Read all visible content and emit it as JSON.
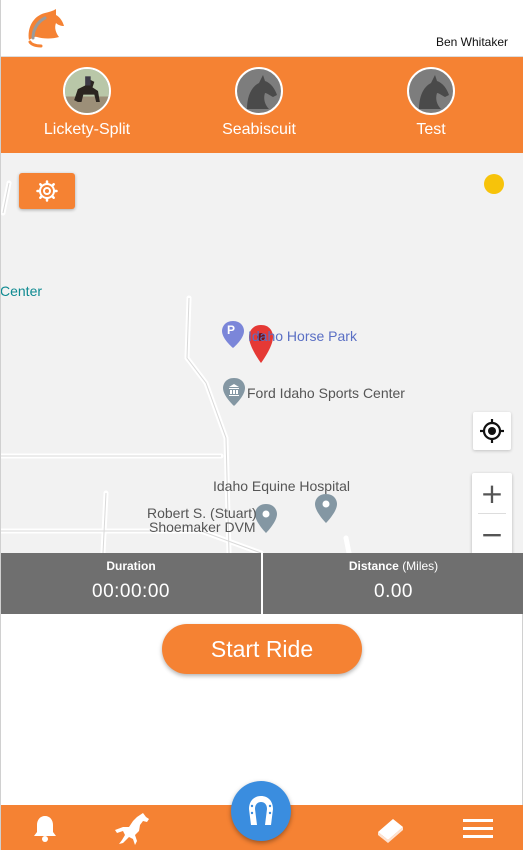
{
  "header": {
    "user_name": "Ben Whitaker",
    "logo_icon": "horse-head-logo-icon"
  },
  "horses": [
    {
      "name": "Lickety-Split",
      "avatar": "photo"
    },
    {
      "name": "Seabiscuit",
      "avatar": "horse-silhouette-icon"
    },
    {
      "name": "Test",
      "avatar": "horse-silhouette-icon"
    }
  ],
  "map": {
    "labels": {
      "center_partial": "Center",
      "horse_park": "Idaho Horse Park",
      "parking_letter": "P",
      "sports_center": "Ford Idaho Sports Center",
      "equine_hospital": "Idaho Equine Hospital",
      "vet_line1": "Robert S. (Stuart)",
      "vet_line2": "Shoemaker DVM"
    },
    "zoom_in": "+",
    "zoom_out": "−",
    "status_color": "#f7c30a"
  },
  "stats": {
    "duration_label": "Duration",
    "duration_value": "00:00:00",
    "distance_label": "Distance",
    "distance_unit": "(Miles)",
    "distance_value": "0.00"
  },
  "actions": {
    "start_ride": "Start Ride"
  },
  "bottom_nav": {
    "items": [
      "bell-icon",
      "horse-rearing-icon",
      "horseshoe-icon",
      "book-icon",
      "menu-icon"
    ]
  },
  "colors": {
    "accent": "#f58233",
    "fab": "#3a8ddf",
    "stats_bg": "#6f6f6f"
  }
}
